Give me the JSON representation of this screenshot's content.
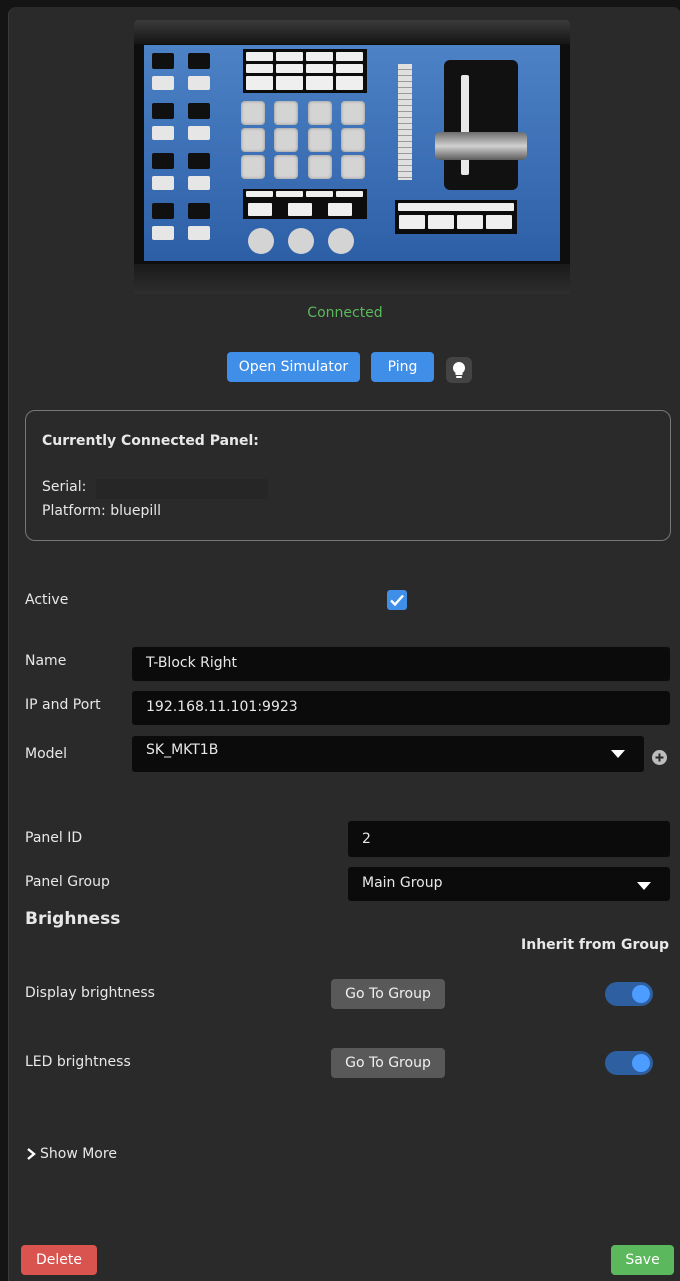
{
  "device": {
    "status": "Connected"
  },
  "actions": {
    "open_simulator": "Open Simulator",
    "ping": "Ping",
    "identify_icon": "lightbulb-icon"
  },
  "connected_panel": {
    "heading": "Currently Connected Panel:",
    "serial_label": "Serial:",
    "platform_label": "Platform: bluepill"
  },
  "form": {
    "active_label": "Active",
    "active_checked": true,
    "name_label": "Name",
    "name_value": "T-Block Right",
    "ip_label": "IP and Port",
    "ip_value": "192.168.11.101:9923",
    "model_label": "Model",
    "model_value": "SK_MKT1B",
    "panel_id_label": "Panel ID",
    "panel_id_value": "2",
    "panel_group_label": "Panel Group",
    "panel_group_value": "Main Group"
  },
  "brightness": {
    "heading": "Brighness",
    "inherit_heading": "Inherit from Group",
    "display_label": "Display brightness",
    "display_go": "Go To Group",
    "display_inherit": true,
    "led_label": "LED brightness",
    "led_go": "Go To Group",
    "led_inherit": true
  },
  "show_more": "Show More",
  "footer": {
    "delete": "Delete",
    "save": "Save"
  },
  "colors": {
    "accent": "#3f8ee8",
    "connected": "#5cb85c",
    "delete": "#d9534f",
    "save": "#5cb85c"
  }
}
